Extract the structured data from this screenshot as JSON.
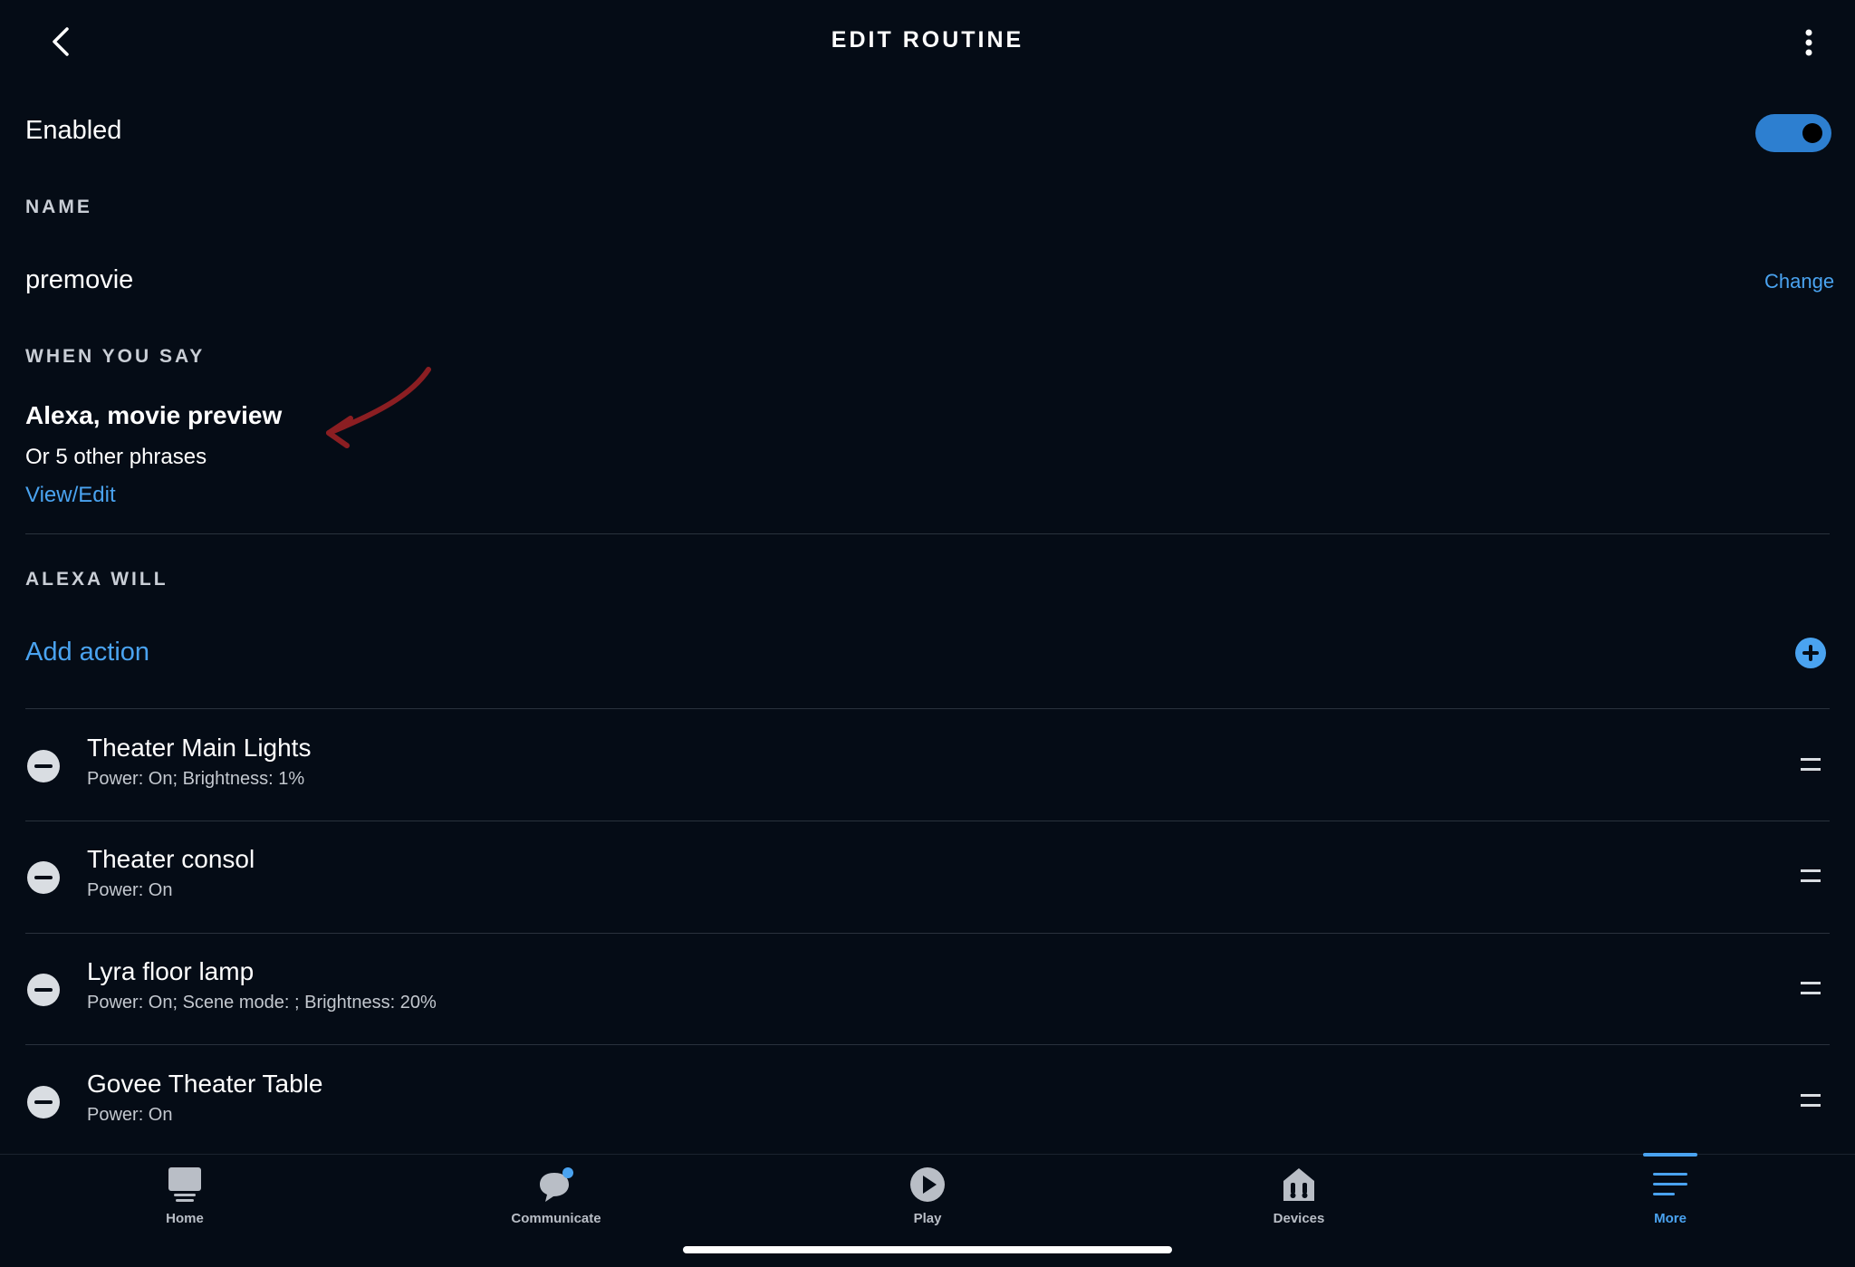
{
  "header": {
    "title": "EDIT ROUTINE"
  },
  "enabled": {
    "label": "Enabled",
    "value": true,
    "accent_color": "#2d7fd0"
  },
  "name_section": {
    "label": "NAME",
    "value": "premovie",
    "change_label": "Change"
  },
  "trigger_section": {
    "label": "WHEN YOU SAY",
    "phrase": "Alexa, movie preview",
    "other_phrases": "Or 5 other phrases",
    "view_edit_label": "View/Edit",
    "annotation_color": "#8b1e22"
  },
  "actions_section": {
    "label": "ALEXA WILL",
    "add_action_label": "Add action",
    "items": [
      {
        "title": "Theater Main Lights",
        "detail": "Power: On; Brightness: 1%"
      },
      {
        "title": "Theater consol",
        "detail": "Power: On"
      },
      {
        "title": "Lyra floor lamp",
        "detail": "Power: On; Scene mode: ; Brightness: 20%"
      },
      {
        "title": "Govee Theater Table",
        "detail": "Power: On"
      }
    ]
  },
  "nav": {
    "items": [
      {
        "label": "Home",
        "icon": "home-icon"
      },
      {
        "label": "Communicate",
        "icon": "chat-bubble-icon",
        "badge": true
      },
      {
        "label": "Play",
        "icon": "play-icon"
      },
      {
        "label": "Devices",
        "icon": "devices-house-icon"
      },
      {
        "label": "More",
        "icon": "menu-lines-icon",
        "active": true
      }
    ],
    "active_color": "#4aa3f0"
  }
}
